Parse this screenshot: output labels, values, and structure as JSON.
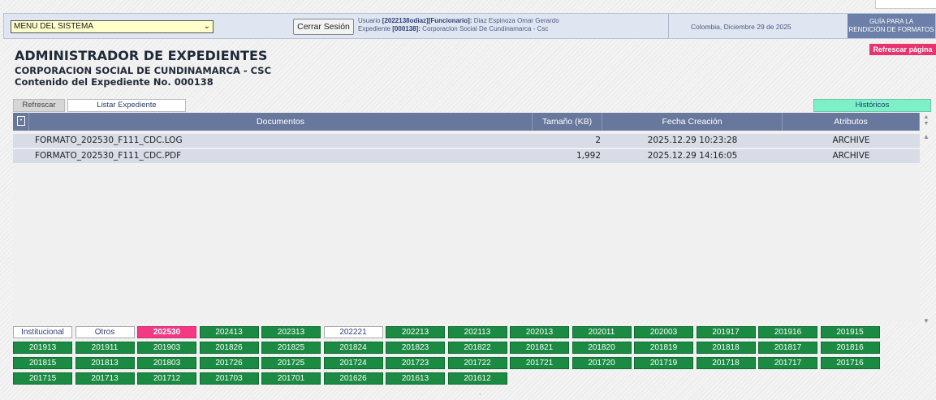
{
  "header": {
    "menu_select": "MENU DEL SISTEMA",
    "logout": "Cerrar Sesión",
    "user_line1_prefix": "Usuario ",
    "user_line1_bold": "[2022138odiaz][Funcionario]:",
    "user_line1_rest": " Diaz Espinoza Omar Gerardo",
    "user_line2_prefix": "Expediente ",
    "user_line2_bold": "[000138]:",
    "user_line2_rest": " Corporacion Social De Cundinamarca - Csc",
    "date": "Colombia, Diciembre 29 de 2025",
    "guide_line1": "GUÍA PARA LA",
    "guide_line2": "RENDICIÓN DE FORMATOS",
    "refresh_page": "Refrescar página"
  },
  "titles": {
    "main": "ADMINISTRADOR DE EXPEDIENTES",
    "entity": "CORPORACION SOCIAL DE CUNDINAMARCA - CSC",
    "content": "Contenido del Expediente No. 000138"
  },
  "tabs": {
    "refresh": "Refrescar",
    "list": "Listar Expediente",
    "historic": "Históricos"
  },
  "grid": {
    "columns": [
      "Documentos",
      "Tamaño (KB)",
      "Fecha Creación",
      "Atributos"
    ],
    "rows": [
      {
        "name": "FORMATO_202530_F111_CDC.LOG",
        "size": "2",
        "date": "2025.12.29 10:23:28",
        "attr": "ARCHIVE"
      },
      {
        "name": "FORMATO_202530_F111_CDC.PDF",
        "size": "1,992",
        "date": "2025.12.29 14:16:05",
        "attr": "ARCHIVE"
      }
    ]
  },
  "periods": {
    "row1": [
      "Institucional",
      "Otros",
      "202530",
      "202413",
      "202313",
      "202221",
      "202213",
      "202113",
      "202013",
      "202011",
      "202003",
      "201917",
      "201916",
      "201915"
    ],
    "row2": [
      "201913",
      "201911",
      "201903",
      "201826",
      "201825",
      "201824",
      "201823",
      "201822",
      "201821",
      "201820",
      "201819",
      "201818",
      "201817",
      "201816"
    ],
    "row3": [
      "201815",
      "201813",
      "201803",
      "201726",
      "201725",
      "201724",
      "201723",
      "201722",
      "201721",
      "201720",
      "201719",
      "201718",
      "201717",
      "201716"
    ],
    "row4": [
      "201715",
      "201713",
      "201712",
      "201703",
      "201701",
      "201626",
      "201613",
      "201612"
    ],
    "selected": "202530",
    "white": [
      "Institucional",
      "Otros",
      "202221"
    ]
  },
  "colors": {
    "selected": "#f23a84",
    "period": "#1b8a43",
    "header": "#68779c",
    "historic": "#7ef0c8"
  }
}
